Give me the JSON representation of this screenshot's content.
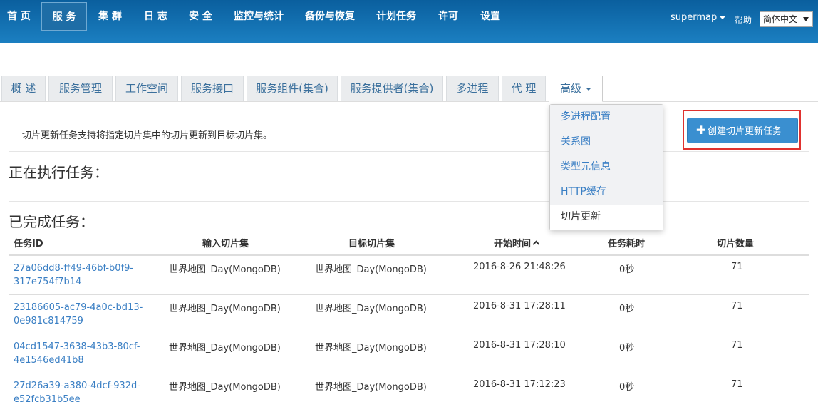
{
  "topnav": {
    "items": [
      {
        "label": "首 页"
      },
      {
        "label": "服 务"
      },
      {
        "label": "集 群"
      },
      {
        "label": "日 志"
      },
      {
        "label": "安 全"
      },
      {
        "label": "监控与统计"
      },
      {
        "label": "备份与恢复"
      },
      {
        "label": "计划任务"
      },
      {
        "label": "许可"
      },
      {
        "label": "设置"
      }
    ],
    "user": "supermap",
    "help": "帮助",
    "language": "简体中文"
  },
  "tabs": [
    {
      "label": "概 述"
    },
    {
      "label": "服务管理"
    },
    {
      "label": "工作空间"
    },
    {
      "label": "服务接口"
    },
    {
      "label": "服务组件(集合)"
    },
    {
      "label": "服务提供者(集合)"
    },
    {
      "label": "多进程"
    },
    {
      "label": "代 理"
    },
    {
      "label": "高级"
    }
  ],
  "dropdown": {
    "items": [
      {
        "label": "多进程配置"
      },
      {
        "label": "关系图"
      },
      {
        "label": "类型元信息"
      },
      {
        "label": "HTTP缓存"
      },
      {
        "label": "切片更新"
      }
    ]
  },
  "main": {
    "description": "切片更新任务支持将指定切片集中的切片更新到目标切片集。",
    "create_button": "创建切片更新任务",
    "running_title": "正在执行任务：",
    "completed_title": "已完成任务："
  },
  "table": {
    "headers": [
      "任务ID",
      "输入切片集",
      "目标切片集",
      "开始时间",
      "任务耗时",
      "切片数量"
    ],
    "rows": [
      {
        "id_line1": "27a06dd8-ff49-46bf-b0f9-",
        "id_line2": "317e754f7b14",
        "input": "世界地图_Day(MongoDB)",
        "target": "世界地图_Day(MongoDB)",
        "start": "2016-8-26 21:48:26",
        "duration": "0秒",
        "count": "71"
      },
      {
        "id_line1": "23186605-ac79-4a0c-bd13-",
        "id_line2": "0e981c814759",
        "input": "世界地图_Day(MongoDB)",
        "target": "世界地图_Day(MongoDB)",
        "start": "2016-8-31 17:28:11",
        "duration": "0秒",
        "count": "71"
      },
      {
        "id_line1": "04cd1547-3638-43b3-80cf-",
        "id_line2": "4e1546ed41b8",
        "input": "世界地图_Day(MongoDB)",
        "target": "世界地图_Day(MongoDB)",
        "start": "2016-8-31 17:28:10",
        "duration": "0秒",
        "count": "71"
      },
      {
        "id_line1": "27d26a39-a380-4dcf-932d-",
        "id_line2": "e52fcb31b5ee",
        "input": "世界地图_Day(MongoDB)",
        "target": "世界地图_Day(MongoDB)",
        "start": "2016-8-31 17:12:23",
        "duration": "0秒",
        "count": "71"
      }
    ]
  }
}
